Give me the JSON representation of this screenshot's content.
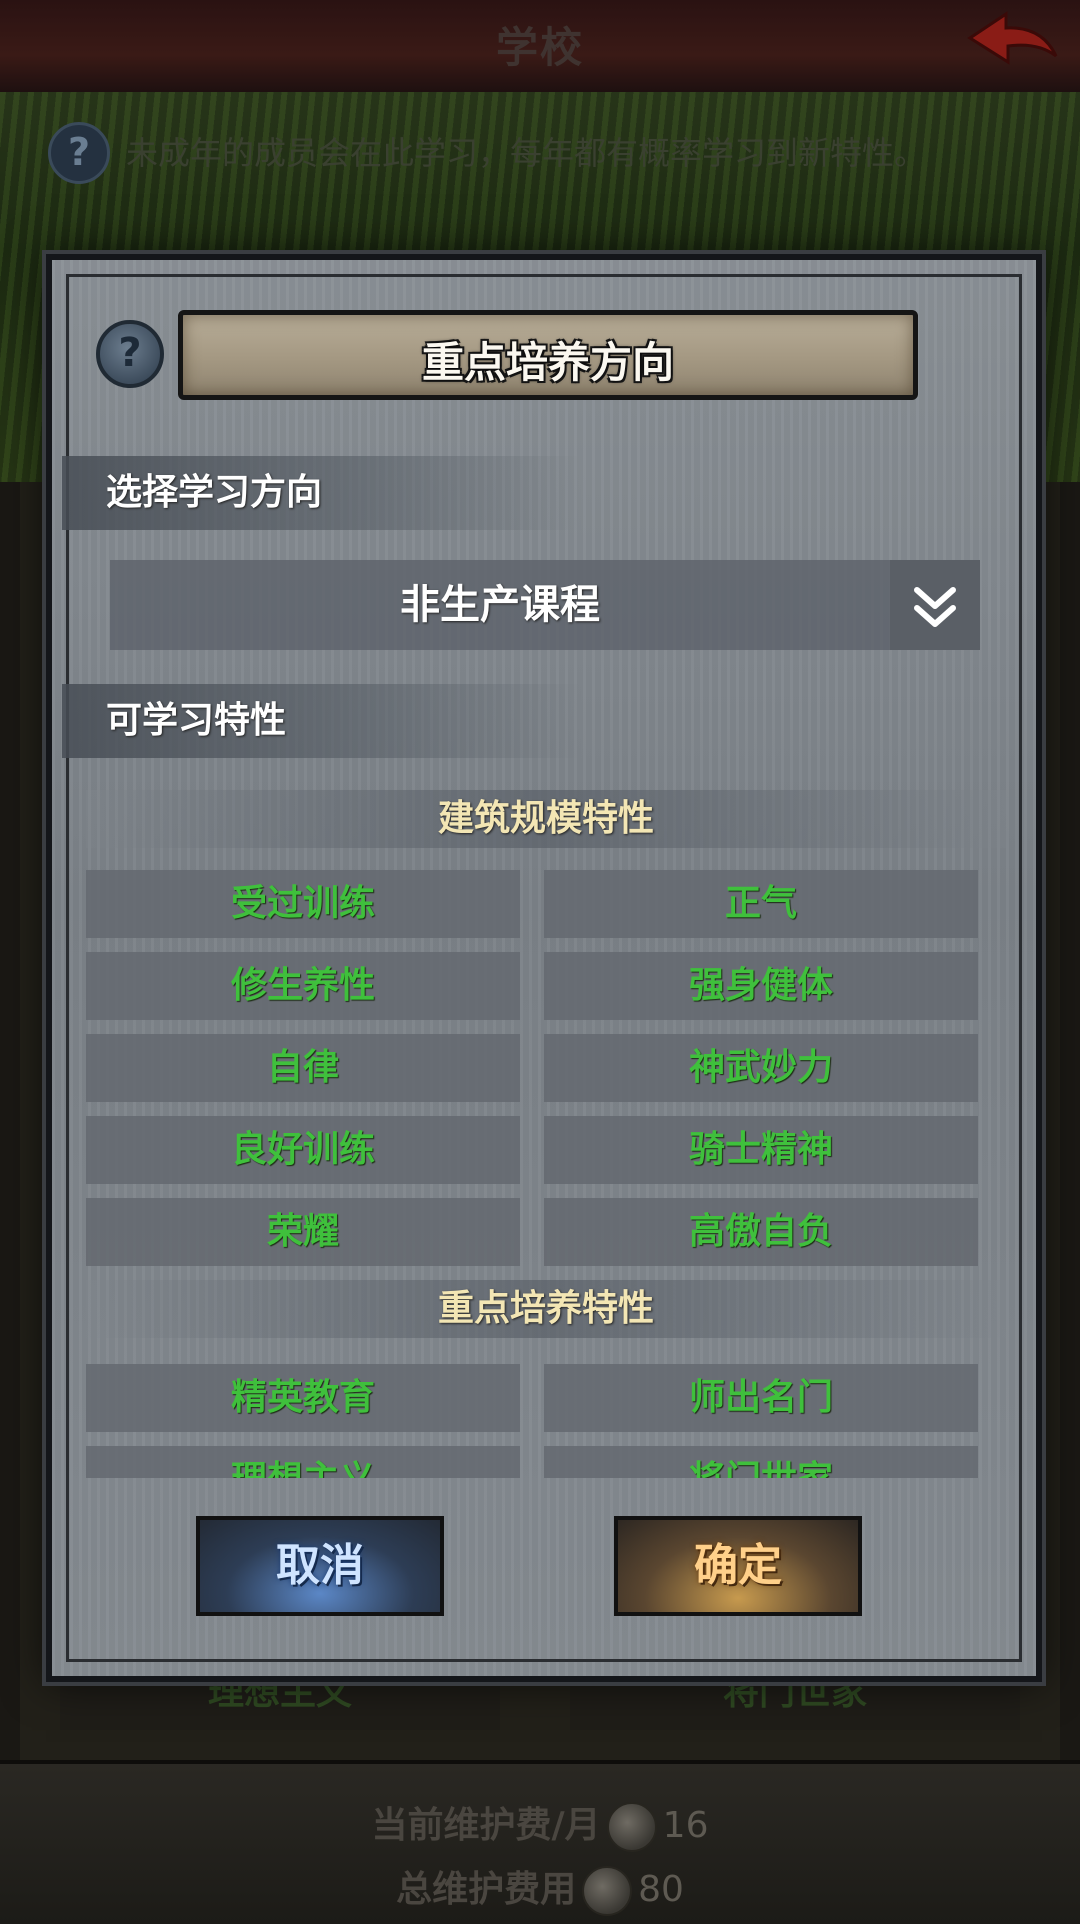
{
  "screen": {
    "title": "学校",
    "info_icon": "question-icon",
    "info_text": "未成年的成员会在此学习，每年都有概率学习到新特性。",
    "back_icon": "back-arrow-icon",
    "bg_rows": [
      {
        "left": "理想主义",
        "right": "将门世家"
      }
    ],
    "maintenance": {
      "monthly_label": "当前维护费/月",
      "monthly_value": "16",
      "total_label": "总维护费用",
      "total_value": "80",
      "coin_icon": "coin-icon"
    }
  },
  "modal": {
    "title": "重点培养方向",
    "help_icon": "question-icon",
    "select_label": "选择学习方向",
    "dropdown": {
      "value": "非生产课程",
      "icon": "double-chevron-down-icon"
    },
    "learnable_label": "可学习特性",
    "groups": [
      {
        "header": "建筑规模特性",
        "traits": [
          "受过训练",
          "正气",
          "修生养性",
          "强身健体",
          "自律",
          "神武妙力",
          "良好训练",
          "骑士精神",
          "荣耀",
          "高傲自负"
        ]
      },
      {
        "header": "重点培养特性",
        "traits": [
          "精英教育",
          "师出名门",
          "理想主义",
          "将门世家"
        ]
      }
    ],
    "buttons": {
      "cancel": "取消",
      "confirm": "确定"
    }
  },
  "colors": {
    "trait_text": "#3fc03c",
    "group_header_text": "#f3e6b4",
    "cancel_accent": "#5b87c6",
    "confirm_accent": "#c79a4e"
  }
}
